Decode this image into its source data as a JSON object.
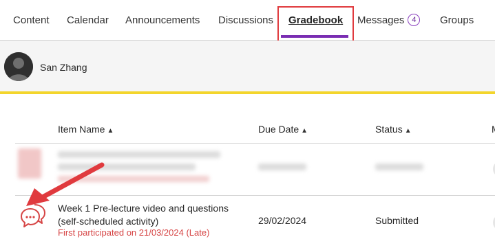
{
  "nav": {
    "tabs": [
      {
        "label": "Content"
      },
      {
        "label": "Calendar"
      },
      {
        "label": "Announcements"
      },
      {
        "label": "Discussions"
      },
      {
        "label": "Gradebook"
      },
      {
        "label": "Messages",
        "badge": "4"
      },
      {
        "label": "Groups"
      }
    ],
    "active_tab": "Gradebook"
  },
  "user": {
    "name": "San Zhang"
  },
  "table": {
    "headers": {
      "item_name": "Item Name",
      "due_date": "Due Date",
      "status": "Status",
      "next_col_partial": "M"
    },
    "rows": [
      {
        "title": "Week 1 Pre-lecture video and questions (self-scheduled activity)",
        "participation": "First participated on 21/03/2024 (Late)",
        "due_date": "29/02/2024",
        "status": "Submitted",
        "icon": "feedback-chat-icon"
      }
    ]
  },
  "colors": {
    "accent_purple": "#7a2db2",
    "highlight_red": "#e03a3e",
    "divider_yellow": "#f3d52b",
    "late_red": "#d64545"
  }
}
